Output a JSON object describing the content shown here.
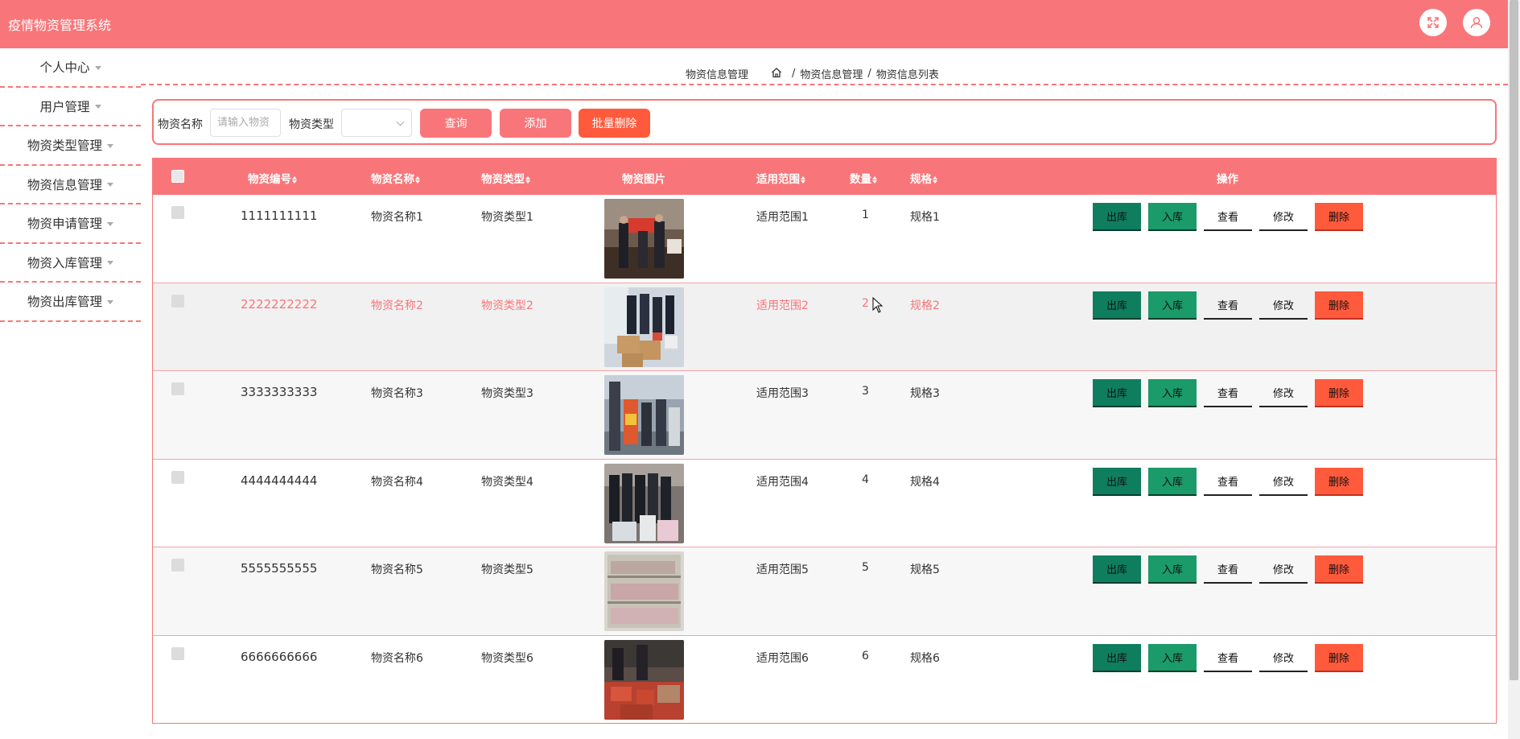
{
  "app": {
    "title": "疫情物资管理系统"
  },
  "topbar_icons": [
    "fullscreen-icon",
    "user-icon"
  ],
  "sidebar": {
    "items": [
      {
        "label": "个人中心"
      },
      {
        "label": "用户管理"
      },
      {
        "label": "物资类型管理"
      },
      {
        "label": "物资信息管理"
      },
      {
        "label": "物资申请管理"
      },
      {
        "label": "物资入库管理"
      },
      {
        "label": "物资出库管理"
      }
    ]
  },
  "breadcrumb": {
    "section": "物资信息管理",
    "path": [
      "物资信息管理",
      "物资信息列表"
    ]
  },
  "search": {
    "name_label": "物资名称",
    "name_placeholder": "请输入物资",
    "type_label": "物资类型",
    "type_value": "",
    "query_label": "查询",
    "add_label": "添加",
    "batch_delete_label": "批量删除"
  },
  "table": {
    "headers": {
      "code": "物资编号",
      "name": "物资名称",
      "type": "物资类型",
      "image": "物资图片",
      "scope": "适用范围",
      "qty": "数量",
      "spec": "规格",
      "actions": "操作"
    },
    "action_labels": {
      "out": "出库",
      "in": "入库",
      "view": "查看",
      "edit": "修改",
      "delete": "删除"
    },
    "rows": [
      {
        "code": "1111111111",
        "name": "物资名称1",
        "type": "物资类型1",
        "scope": "适用范围1",
        "qty": "1",
        "spec": "规格1"
      },
      {
        "code": "2222222222",
        "name": "物资名称2",
        "type": "物资类型2",
        "scope": "适用范围2",
        "qty": "2",
        "spec": "规格2"
      },
      {
        "code": "3333333333",
        "name": "物资名称3",
        "type": "物资类型3",
        "scope": "适用范围3",
        "qty": "3",
        "spec": "规格3"
      },
      {
        "code": "4444444444",
        "name": "物资名称4",
        "type": "物资类型4",
        "scope": "适用范围4",
        "qty": "4",
        "spec": "规格4"
      },
      {
        "code": "5555555555",
        "name": "物资名称5",
        "type": "物资类型5",
        "scope": "适用范围5",
        "qty": "5",
        "spec": "规格5"
      },
      {
        "code": "6666666666",
        "name": "物资名称6",
        "type": "物资类型6",
        "scope": "适用范围6",
        "qty": "6",
        "spec": "规格6"
      }
    ]
  },
  "colors": {
    "brand": "#f87679",
    "btn_out": "#0f7e5f",
    "btn_in": "#1b9a6a",
    "btn_delete": "#ff5a3c",
    "btn_batch_delete": "#ff5a3c"
  }
}
